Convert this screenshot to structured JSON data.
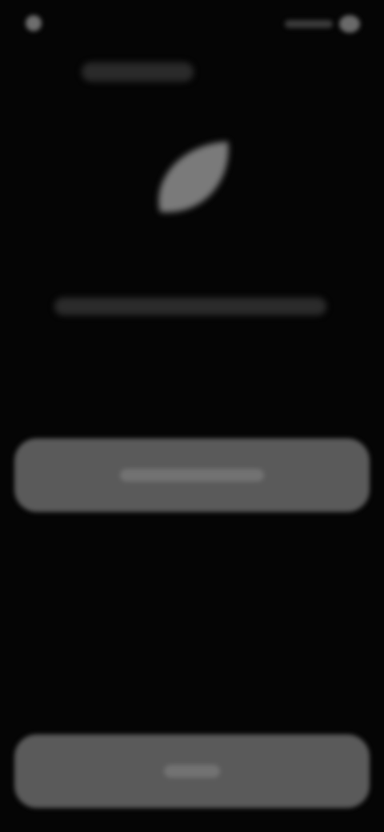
{
  "status_bar": {
    "left_icon": "app-indicator-icon",
    "right_icons": [
      "signal-icon",
      "battery-icon"
    ]
  },
  "header": {
    "title": ""
  },
  "logo": {
    "icon": "leaf-icon",
    "color": "#7a7a7a"
  },
  "message": {
    "text": ""
  },
  "primary_button": {
    "label": ""
  },
  "secondary_button": {
    "label": ""
  },
  "colors": {
    "background": "#050505",
    "button": "#5a5a5a",
    "text_muted": "#2b2b2b"
  }
}
